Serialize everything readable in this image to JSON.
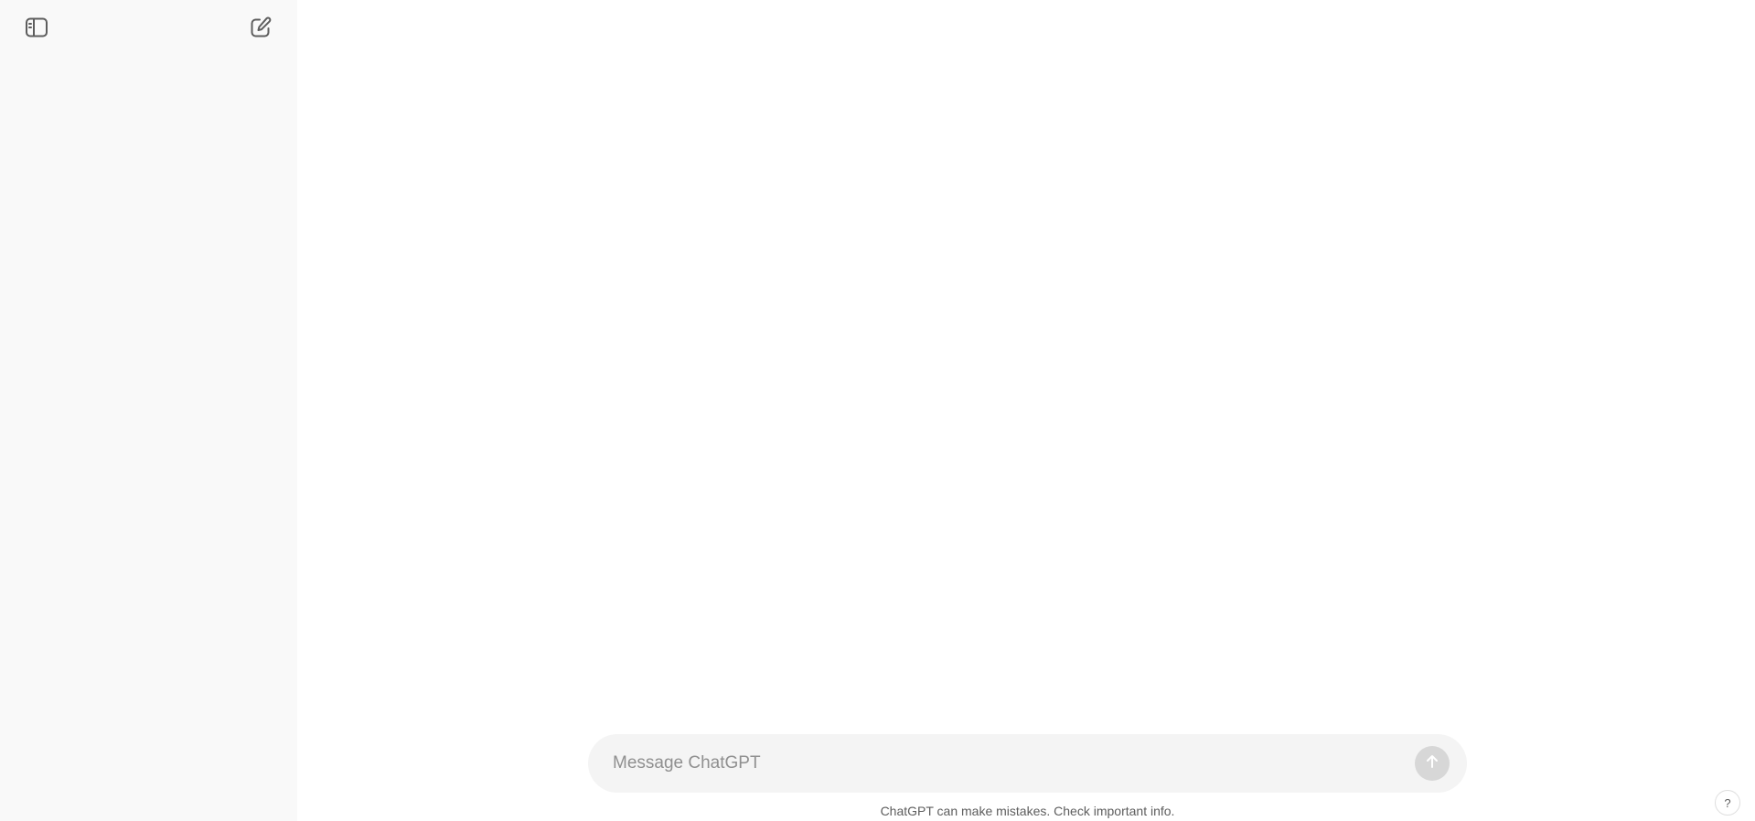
{
  "sidebar": {
    "toggle_icon": "sidebar-toggle-icon",
    "new_chat_icon": "new-chat-icon",
    "background": "#f9f9f9"
  },
  "composer": {
    "placeholder": "Message ChatGPT",
    "value": "",
    "send_icon": "arrow-up-icon",
    "background": "#f4f4f4"
  },
  "footer": {
    "disclaimer": "ChatGPT can make mistakes. Check important info.",
    "help_label": "?"
  }
}
